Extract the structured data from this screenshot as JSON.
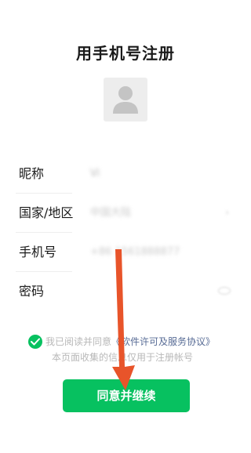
{
  "page": {
    "title": "用手机号注册"
  },
  "avatar": {
    "icon": "user-silhouette-icon"
  },
  "form": {
    "nickname": {
      "label": "昵称",
      "value": "Vi"
    },
    "region": {
      "label": "国家/地区",
      "value": "中国大陆"
    },
    "phone": {
      "label": "手机号",
      "value": "+86 1561888877"
    },
    "password": {
      "label": "密码",
      "value": ""
    }
  },
  "agreement": {
    "prefix": "我已阅读并同意",
    "link": "《软件许可及服务协议》",
    "note": "本页面收集的信息仅用于注册帐号",
    "checked": true
  },
  "actions": {
    "submit_label": "同意并继续"
  },
  "colors": {
    "accent": "#07c160",
    "arrow": "#e8542a",
    "link": "#576b95"
  }
}
